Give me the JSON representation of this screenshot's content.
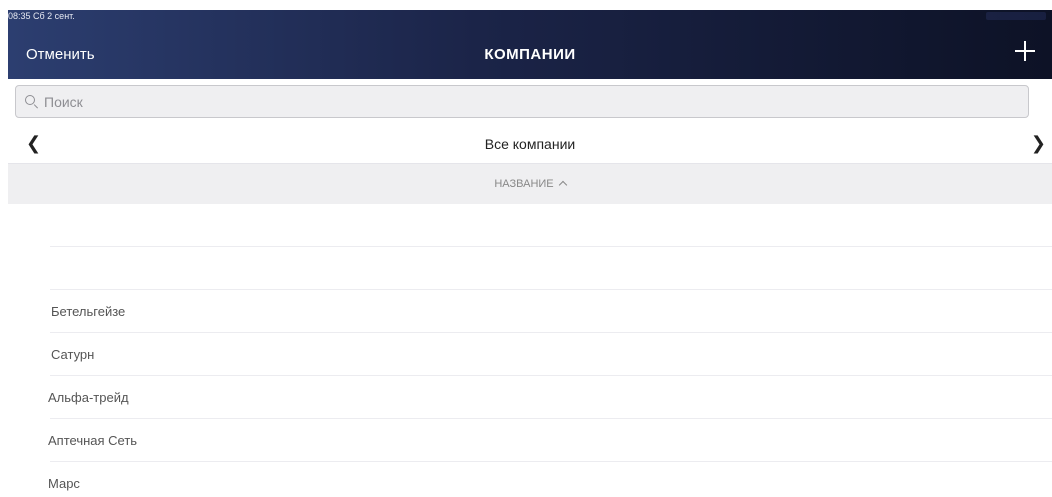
{
  "status_bar": {
    "time_date": "08:35  Сб 2 сент."
  },
  "header": {
    "cancel_label": "Отменить",
    "title": "КОМПАНИИ",
    "add_icon": "plus-icon"
  },
  "search": {
    "placeholder": "Поиск",
    "value": ""
  },
  "filter": {
    "label": "Все компании",
    "prev_icon": "chevron-left-icon",
    "next_icon": "chevron-right-icon"
  },
  "column_header": {
    "label": "НАЗВАНИЕ",
    "sort_icon": "chevron-up-icon"
  },
  "companies": {
    "items": [
      "",
      "",
      "Бетельгейзе",
      "Сатурн",
      "Альфа-трейд",
      "Аптечная Сеть",
      "Марс"
    ]
  },
  "colors": {
    "header_start": "#2c3e70",
    "header_end": "#0d1226",
    "section_bg": "#efeff1"
  }
}
